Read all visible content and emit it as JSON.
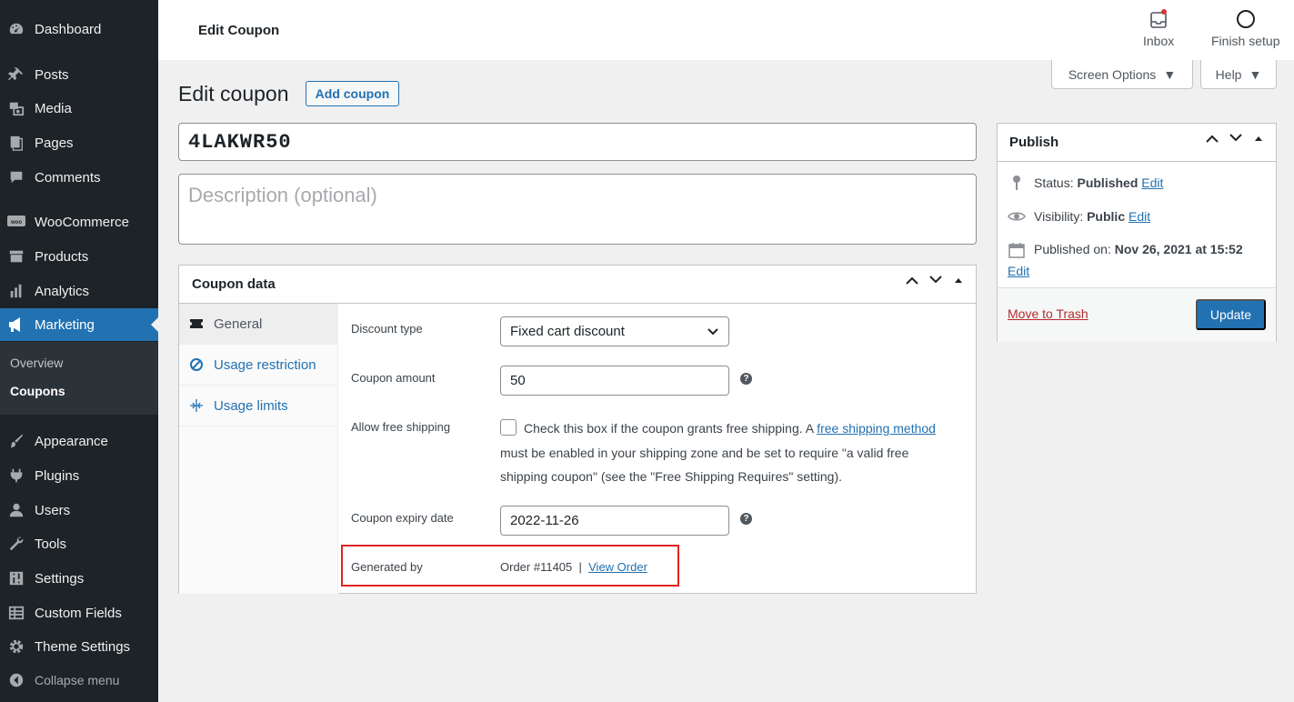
{
  "sidebar": {
    "items": [
      {
        "label": "Dashboard",
        "icon": "dashboard-icon"
      },
      {
        "label": "Posts",
        "icon": "pin-icon"
      },
      {
        "label": "Media",
        "icon": "media-icon"
      },
      {
        "label": "Pages",
        "icon": "pages-icon"
      },
      {
        "label": "Comments",
        "icon": "comment-icon"
      },
      {
        "label": "WooCommerce",
        "icon": "woocommerce-icon"
      },
      {
        "label": "Products",
        "icon": "archive-icon"
      },
      {
        "label": "Analytics",
        "icon": "bar-chart-icon"
      },
      {
        "label": "Marketing",
        "icon": "megaphone-icon"
      },
      {
        "label": "Appearance",
        "icon": "brush-icon"
      },
      {
        "label": "Plugins",
        "icon": "plug-icon"
      },
      {
        "label": "Users",
        "icon": "user-icon"
      },
      {
        "label": "Tools",
        "icon": "wrench-icon"
      },
      {
        "label": "Settings",
        "icon": "sliders-icon"
      },
      {
        "label": "Custom Fields",
        "icon": "table-icon"
      },
      {
        "label": "Theme Settings",
        "icon": "gear-icon"
      }
    ],
    "submenu": [
      "Overview",
      "Coupons"
    ],
    "collapse_label": "Collapse menu"
  },
  "topbar": {
    "title": "Edit Coupon",
    "inbox_label": "Inbox",
    "finish_setup_label": "Finish setup"
  },
  "screen_options_label": "Screen Options",
  "help_label": "Help",
  "page": {
    "heading": "Edit coupon",
    "add_coupon_label": "Add coupon",
    "coupon_code": "4LAKWR50",
    "description_placeholder": "Description (optional)"
  },
  "coupon_data": {
    "title": "Coupon data",
    "tabs": [
      "General",
      "Usage restriction",
      "Usage limits"
    ],
    "discount_type_label": "Discount type",
    "discount_type_value": "Fixed cart discount",
    "coupon_amount_label": "Coupon amount",
    "coupon_amount_value": "50",
    "free_shipping_label": "Allow free shipping",
    "free_shipping_text_1": "Check this box if the coupon grants free shipping. A ",
    "free_shipping_link": "free shipping method",
    "free_shipping_text_2": " must be enabled in your shipping zone and be set to require \"a valid free shipping coupon\" (see the \"Free Shipping Requires\" setting).",
    "expiry_label": "Coupon expiry date",
    "expiry_value": "2022-11-26",
    "generated_by_label": "Generated by",
    "generated_by_value": "Order #11405",
    "separator": "|",
    "view_order_label": "View Order"
  },
  "publish": {
    "title": "Publish",
    "status_label": "Status:",
    "status_value": "Published",
    "visibility_label": "Visibility:",
    "visibility_value": "Public",
    "published_on_label": "Published on:",
    "published_on_value": "Nov 26, 2021 at 15:52",
    "edit_label": "Edit",
    "trash_label": "Move to Trash",
    "update_label": "Update"
  },
  "colors": {
    "sidebar_bg": "#1d2327",
    "accent": "#2271b1",
    "highlight_border": "#e02424",
    "trash": "#b32d2e"
  }
}
